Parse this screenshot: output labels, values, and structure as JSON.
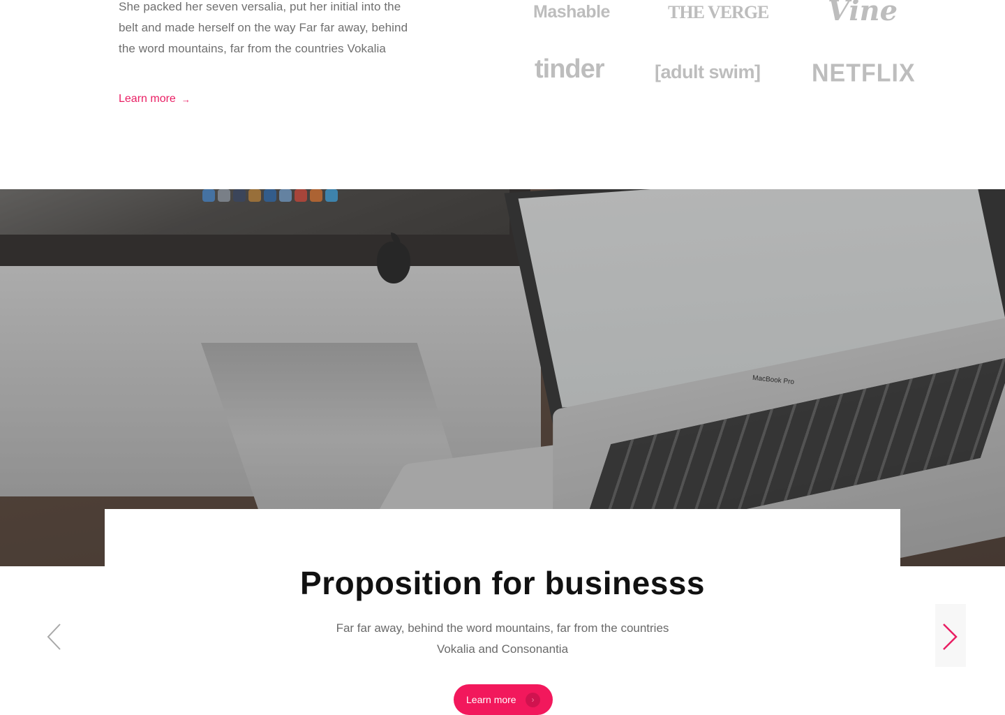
{
  "intro": {
    "text": "She packed her seven versalia, put her initial into the belt and made herself on the way Far far away, behind the word mountains, far from the countries Vokalia",
    "link_label": "Learn more",
    "link_arrow": "→"
  },
  "logos": [
    "Mashable",
    "THE VERGE",
    "Vine",
    "tinder",
    "[adult swim]",
    "NETFLIX"
  ],
  "hero": {
    "laptop_label": "MacBook Pro"
  },
  "card": {
    "title": "Proposition for businesss",
    "subtitle": "Far far away, behind the word mountains, far from the countries Vokalia and Consonantia",
    "button_label": "Learn more",
    "button_icon": "›"
  },
  "carousel": {
    "prev_icon": "chevron-left-icon",
    "next_icon": "chevron-right-icon"
  },
  "colors": {
    "accent": "#e91e63",
    "button": "#f2185c",
    "logo_gray": "#bdbdbd"
  }
}
